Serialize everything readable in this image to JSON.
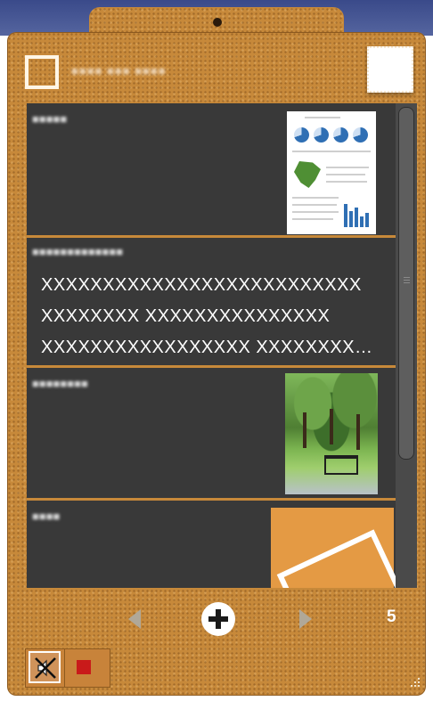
{
  "header": {
    "title": "■■■■ ■■■ ■■■■"
  },
  "cards": [
    {
      "label": "■■■■■",
      "kind": "image-doc"
    },
    {
      "label": "■■■■■■■■■■■■■",
      "kind": "text",
      "text": "XXXXXXXXXXXXXXXXXXXXXXXXXX\nXXXXXXXX XXXXXXXXXXXXXXX\nXXXXXXXXXXXXXXXXX XXXXXXXX…"
    },
    {
      "label": "■■■■■■■■",
      "kind": "image-park"
    },
    {
      "label": "■■■■",
      "kind": "image-orange"
    }
  ],
  "nav": {
    "count": "5"
  },
  "colors": {
    "cork": "#c7893a",
    "list_bg": "#3c3c3c",
    "stop_red": "#c91a1a"
  },
  "icons": {
    "add": "plus-circle-icon",
    "mute": "mute-icon",
    "stop": "stop-icon"
  }
}
